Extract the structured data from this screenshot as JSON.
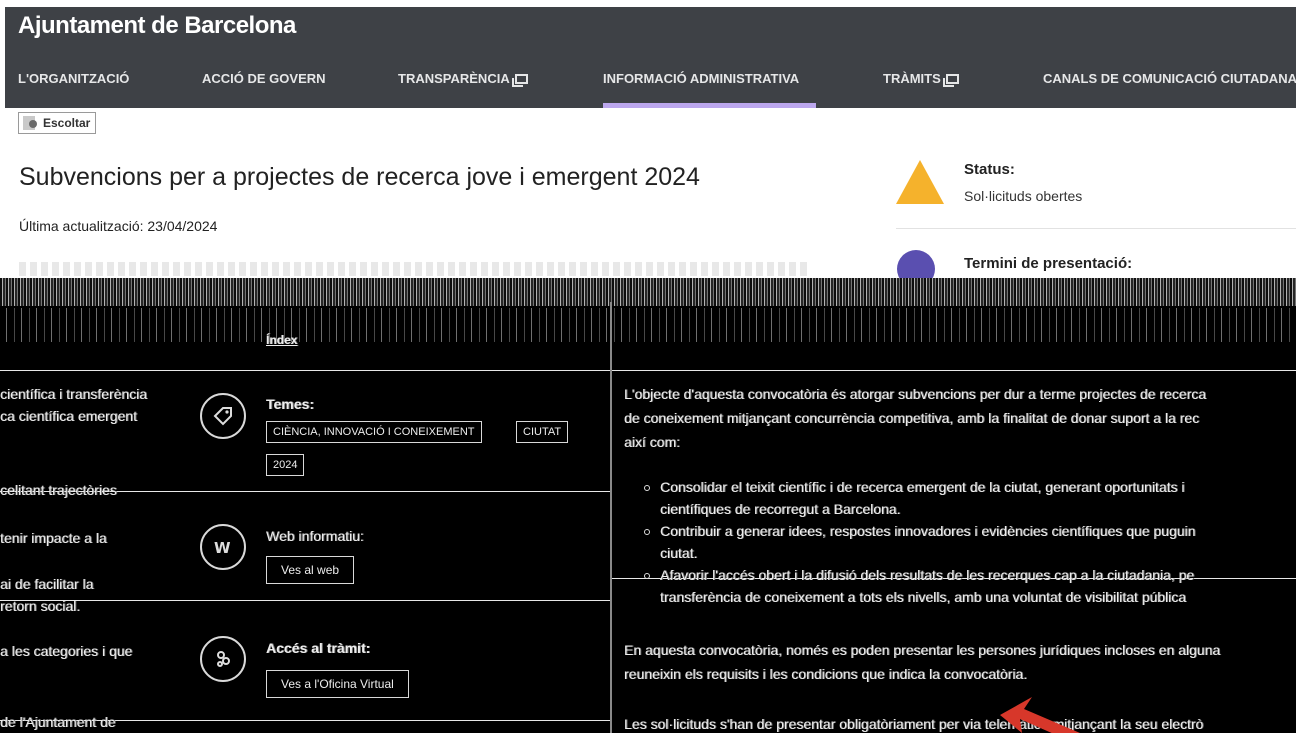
{
  "header": {
    "brand": "Ajuntament de Barcelona",
    "nav": [
      {
        "label": "L'ORGANITZACIÓ",
        "external": false,
        "active": false
      },
      {
        "label": "ACCIÓ DE GOVERN",
        "external": false,
        "active": false
      },
      {
        "label": "TRANSPARÈNCIA",
        "external": true,
        "active": false
      },
      {
        "label": "INFORMACIÓ ADMINISTRATIVA",
        "external": false,
        "active": true
      },
      {
        "label": "TRÀMITS",
        "external": true,
        "active": false
      },
      {
        "label": "CANALS DE COMUNICACIÓ CIUTADANA",
        "external": false,
        "active": false
      }
    ]
  },
  "listen": {
    "label": "Escoltar",
    "icon": "speaker-icon"
  },
  "page": {
    "title": "Subvencions per a projectes de recerca jove i emergent 2024",
    "updated": "Última actualització: 23/04/2024"
  },
  "sidebar": {
    "status_label": "Status:",
    "status_value": "Sol·licituds obertes",
    "deadline_label": "Termini de presentació:",
    "status_color": "#f5b22c"
  },
  "details": {
    "themes_label": "Temes:",
    "themes": [
      "CIÈNCIA, INNOVACIÓ I CONEIXEMENT",
      "CIUTAT",
      "2024"
    ],
    "web_label": "Web informatiu:",
    "web_button": "Ves al web",
    "procedure_label": "Accés al tràmit:",
    "procedure_button": "Ves a l'Oficina Virtual",
    "tab_label": "Índex"
  },
  "left_fragments": [
    "científica i transferència",
    "ca científica emergent",
    "celitant trajectòries",
    "tenir impacte a la",
    "ai de facilitar la",
    "retorn social.",
    "a les categories i que",
    "de l'Ajuntament de"
  ],
  "content": {
    "intro": "L'objecte d'aquesta convocatòria és atorgar subvencions per dur a terme projectes de recerca ",
    "intro2": "de coneixement mitjançant concurrència competitiva, amb la finalitat de donar suport a la rec",
    "intro3": "així com:",
    "bullets": [
      [
        "Consolidar el teixit científic i de recerca emergent de la ciutat, generant oportunitats i",
        "científiques de recorregut a Barcelona."
      ],
      [
        "Contribuir a generar idees, respostes innovadores i evidències científiques que puguin",
        "ciutat."
      ],
      [
        "Afavorir l'accés obert i la difusió dels resultats de les recerques cap a la ciutadania, pe",
        "transferència de coneixement a tots els nivells, amb una voluntat de visibilitat pública"
      ]
    ],
    "para2": "En aquesta convocatòria, només es poden presentar les persones jurídiques incloses en alguna",
    "para2b": "reuneixin els requisits i les condicions que indica la convocatòria.",
    "para3": "Les sol·licituds s'han de presentar obligatòriament per via telemàtica mitjançant la seu electrò"
  }
}
